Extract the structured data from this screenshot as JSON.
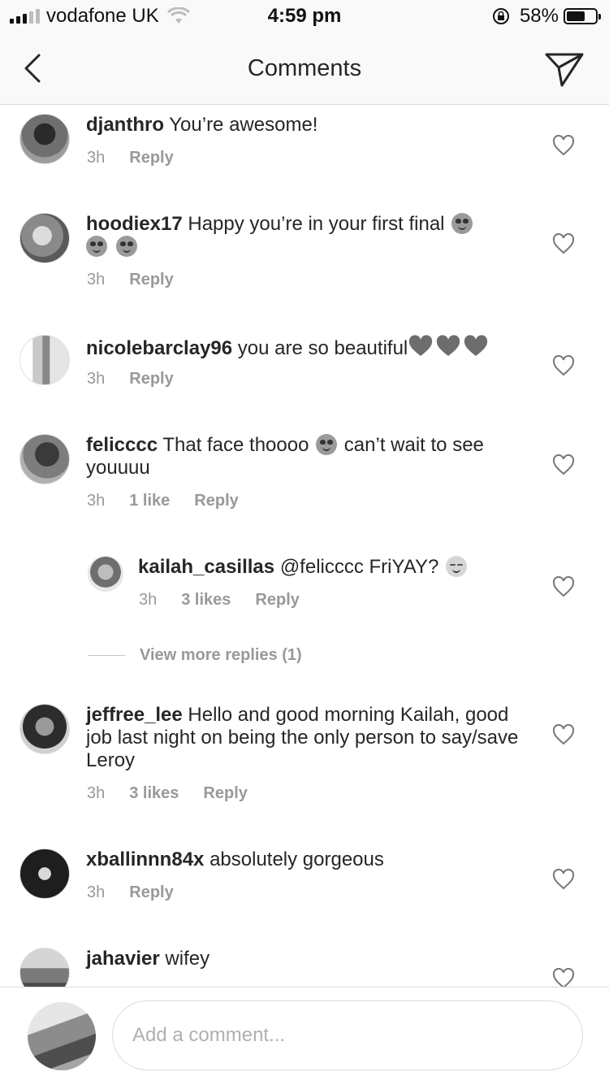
{
  "status": {
    "carrier": "vodafone UK",
    "time": "4:59 pm",
    "battery": "58%",
    "battery_level": 0.58
  },
  "header": {
    "title": "Comments",
    "back_icon": "chevron-left-icon",
    "send_icon": "paper-plane-icon"
  },
  "comments": [
    {
      "user": "djanthro",
      "text": "You’re awesome!",
      "time": "3h",
      "reply": "Reply"
    },
    {
      "user": "hoodiex17",
      "text": "Happy you’re in your first final",
      "emoji_count": 3,
      "time": "3h",
      "reply": "Reply"
    },
    {
      "user": "nicolebarclay96",
      "text": "you are so beautiful",
      "hearts": 3,
      "time": "3h",
      "reply": "Reply"
    },
    {
      "user": "felicccc",
      "text_a": "That face thoooo",
      "text_b": "can’t wait to see youuuu",
      "time": "3h",
      "likes": "1 like",
      "reply": "Reply"
    },
    {
      "user": "kailah_casillas",
      "text": "@felicccc FriYAY?",
      "time": "3h",
      "likes": "3 likes",
      "reply": "Reply"
    },
    {
      "user": "jeffree_lee",
      "text": "Hello and good morning Kailah, good job last night on being the only person to say/save Leroy",
      "time": "3h",
      "likes": "3 likes",
      "reply": "Reply"
    },
    {
      "user": "xballinnn84x",
      "text": "absolutely gorgeous",
      "time": "3h",
      "reply": "Reply"
    },
    {
      "user": "jahavier",
      "text": "wifey"
    }
  ],
  "view_more": "View more replies (1)",
  "composer": {
    "placeholder": "Add a comment..."
  }
}
